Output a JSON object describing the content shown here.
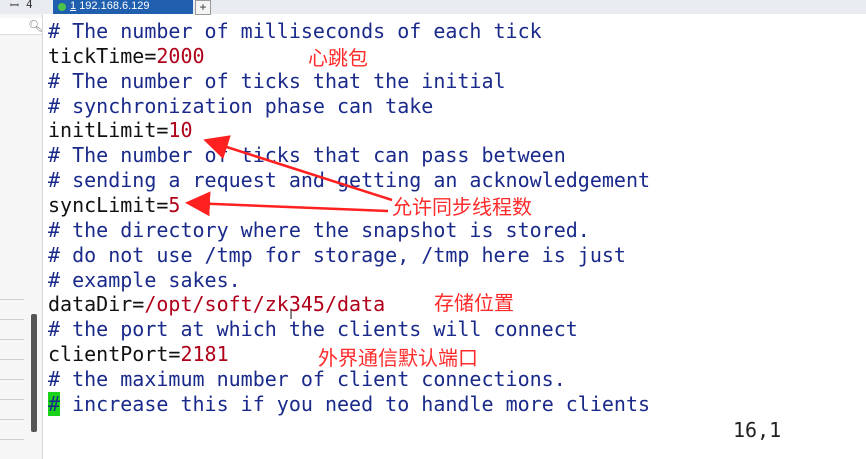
{
  "tab": {
    "index": "1",
    "host": "192.168.6.129",
    "add": "+"
  },
  "topbar": {
    "pin": "ꟷ",
    "pin_label": "4"
  },
  "sidebar": {
    "search_icon": "search-icon"
  },
  "lines": [
    {
      "type": "comment",
      "text": "# The number of milliseconds of each tick"
    },
    {
      "type": "kv",
      "key": "tickTime=",
      "value": "2000"
    },
    {
      "type": "comment",
      "text": "# The number of ticks that the initial"
    },
    {
      "type": "comment",
      "text": "# synchronization phase can take"
    },
    {
      "type": "kv",
      "key": "initLimit=",
      "value": "10"
    },
    {
      "type": "comment",
      "text": "# The number of ticks that can pass between"
    },
    {
      "type": "comment",
      "text": "# sending a request and getting an acknowledgement"
    },
    {
      "type": "kv",
      "key": "syncLimit=",
      "value": "5"
    },
    {
      "type": "comment",
      "text": "# the directory where the snapshot is stored."
    },
    {
      "type": "comment",
      "text": "# do not use /tmp for storage, /tmp here is just"
    },
    {
      "type": "comment",
      "text": "# example sakes."
    },
    {
      "type": "kv",
      "key": "dataDir=",
      "value": "/opt/soft/zk345/data"
    },
    {
      "type": "comment",
      "text": "# the port at which the clients will connect"
    },
    {
      "type": "kv",
      "key": "clientPort=",
      "value": "2181"
    },
    {
      "type": "comment",
      "text": "# the maximum number of client connections."
    },
    {
      "type": "cursorline",
      "cursor": "#",
      "text": " increase this if you need to handle more clients"
    }
  ],
  "annotations": {
    "heartbeat": "心跳包",
    "sync_threads": "允许同步线程数",
    "storage": "存储位置",
    "port": "外界通信默认端口"
  },
  "status": {
    "position": "16,1"
  },
  "colors": {
    "comment": "#1a2a8a",
    "value": "#b0001a",
    "annotation": "#ff2a2a",
    "cursor": "#19d219",
    "tab": "#1f5fae"
  }
}
